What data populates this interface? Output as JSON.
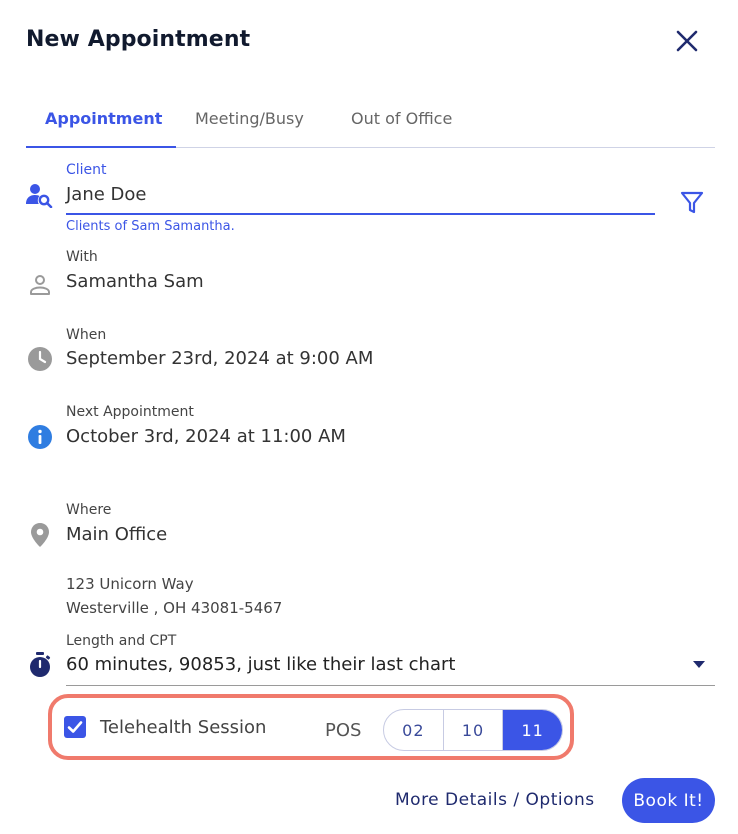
{
  "dialog": {
    "title": "New Appointment"
  },
  "tabs": [
    {
      "label": "Appointment",
      "active": true
    },
    {
      "label": "Meeting/Busy",
      "active": false
    },
    {
      "label": "Out of Office",
      "active": false
    }
  ],
  "client": {
    "label": "Client",
    "value": "Jane Doe",
    "helper": "Clients of Sam Samantha."
  },
  "with": {
    "label": "With",
    "value": "Samantha Sam"
  },
  "when": {
    "label": "When",
    "value": "September 23rd, 2024 at 9:00 AM"
  },
  "next_appointment": {
    "label": "Next Appointment",
    "value": "October 3rd, 2024 at 11:00 AM"
  },
  "where": {
    "label": "Where",
    "value": "Main Office",
    "address_line1": "123 Unicorn Way",
    "address_line2": "Westerville , OH 43081-5467"
  },
  "length_cpt": {
    "label": "Length and CPT",
    "value": "60 minutes, 90853, just like their last chart"
  },
  "telehealth": {
    "label": "Telehealth Session",
    "checked": true,
    "pos_label": "POS",
    "pos_options": [
      "02",
      "10",
      "11"
    ],
    "pos_selected": "11"
  },
  "actions": {
    "more_details": "More Details / Options",
    "book": "Book It!"
  },
  "icons": {
    "close": "close-icon",
    "client": "user-search-icon",
    "filter": "filter-icon",
    "with": "person-icon",
    "when": "clock-icon",
    "next": "info-icon",
    "where": "location-pin-icon",
    "length": "stopwatch-icon",
    "dropdown": "dropdown-arrow-icon",
    "check": "checkmark-icon"
  },
  "colors": {
    "accent": "#3b55e6",
    "title": "#111a2e",
    "highlight": "#f07a6c",
    "icon_gray": "#9a9a9a",
    "dark_navy": "#1f2a6e"
  }
}
